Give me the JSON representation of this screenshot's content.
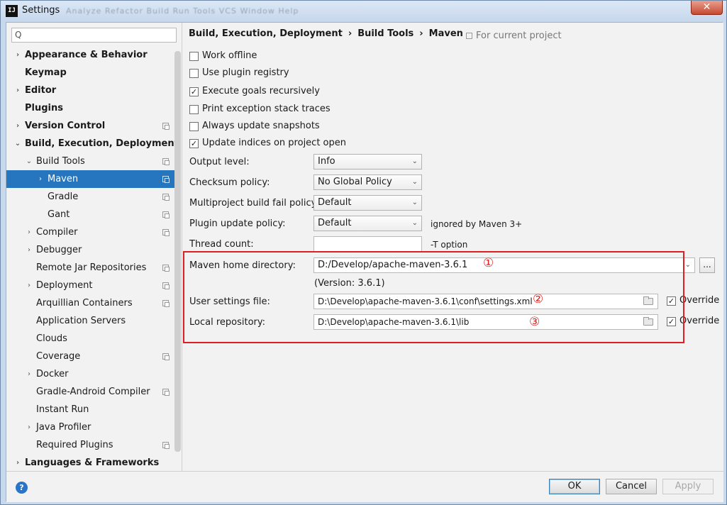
{
  "window": {
    "title": "Settings",
    "logo_text": "IJ",
    "background_menu": "Analyze  Refactor  Build  Run  Tools  VCS  Window  Help",
    "close_glyph": "✕"
  },
  "sidebar": {
    "search_placeholder": "",
    "search_icon": "Q",
    "items": [
      {
        "label": "Appearance & Behavior",
        "arrow": "›"
      },
      {
        "label": "Keymap"
      },
      {
        "label": "Editor",
        "arrow": "›"
      },
      {
        "label": "Plugins"
      },
      {
        "label": "Version Control",
        "arrow": "›"
      },
      {
        "label": "Build, Execution, Deployment",
        "arrow": "⌄"
      },
      {
        "label": "Build Tools",
        "arrow": "⌄"
      },
      {
        "label": "Maven",
        "arrow": "›"
      },
      {
        "label": "Gradle"
      },
      {
        "label": "Gant"
      },
      {
        "label": "Compiler",
        "arrow": "›"
      },
      {
        "label": "Debugger",
        "arrow": "›"
      },
      {
        "label": "Remote Jar Repositories"
      },
      {
        "label": "Deployment",
        "arrow": "›"
      },
      {
        "label": "Arquillian Containers"
      },
      {
        "label": "Application Servers"
      },
      {
        "label": "Clouds"
      },
      {
        "label": "Coverage"
      },
      {
        "label": "Docker",
        "arrow": "›"
      },
      {
        "label": "Gradle-Android Compiler"
      },
      {
        "label": "Instant Run"
      },
      {
        "label": "Java Profiler",
        "arrow": "›"
      },
      {
        "label": "Required Plugins"
      },
      {
        "label": "Languages & Frameworks",
        "arrow": "›"
      }
    ]
  },
  "breadcrumb": {
    "parts": [
      "Build, Execution, Deployment",
      "Build Tools",
      "Maven"
    ],
    "separator": "›",
    "scope_label": "For current project"
  },
  "checkboxes": [
    {
      "label": "Work offline",
      "checked": false
    },
    {
      "label": "Use plugin registry",
      "checked": false
    },
    {
      "label": "Execute goals recursively",
      "checked": true
    },
    {
      "label": "Print exception stack traces",
      "checked": false
    },
    {
      "label": "Always update snapshots",
      "checked": false
    },
    {
      "label": "Update indices on project open",
      "checked": true
    }
  ],
  "check_glyph": "✓",
  "form": {
    "output_level": {
      "label": "Output level:",
      "value": "Info"
    },
    "checksum_policy": {
      "label": "Checksum policy:",
      "value": "No Global Policy"
    },
    "multiproject_fail_policy": {
      "label": "Multiproject build fail policy:",
      "value": "Default"
    },
    "plugin_update_policy": {
      "label": "Plugin update policy:",
      "value": "Default",
      "hint": "ignored by Maven 3+"
    },
    "thread_count": {
      "label": "Thread count:",
      "value": "",
      "hint": "-T option"
    },
    "maven_home": {
      "label": "Maven home directory:",
      "value": "D:/Develop/apache-maven-3.6.1",
      "version": "(Version: 3.6.1)",
      "browse_label": "..."
    },
    "user_settings": {
      "label": "User settings file:",
      "value": "D:\\Develop\\apache-maven-3.6.1\\conf\\settings.xml",
      "override_label": "Override",
      "override_checked": true
    },
    "local_repository": {
      "label": "Local repository:",
      "value": "D:\\Develop\\apache-maven-3.6.1\\lib",
      "override_label": "Override",
      "override_checked": true
    }
  },
  "annotations": {
    "one": "①",
    "two": "②",
    "three": "③",
    "color": "#e02020"
  },
  "buttons": {
    "ok": "OK",
    "cancel": "Cancel",
    "apply": "Apply",
    "help": "?"
  },
  "colors": {
    "selection": "#2675bf",
    "accent": "#2b74c8"
  }
}
